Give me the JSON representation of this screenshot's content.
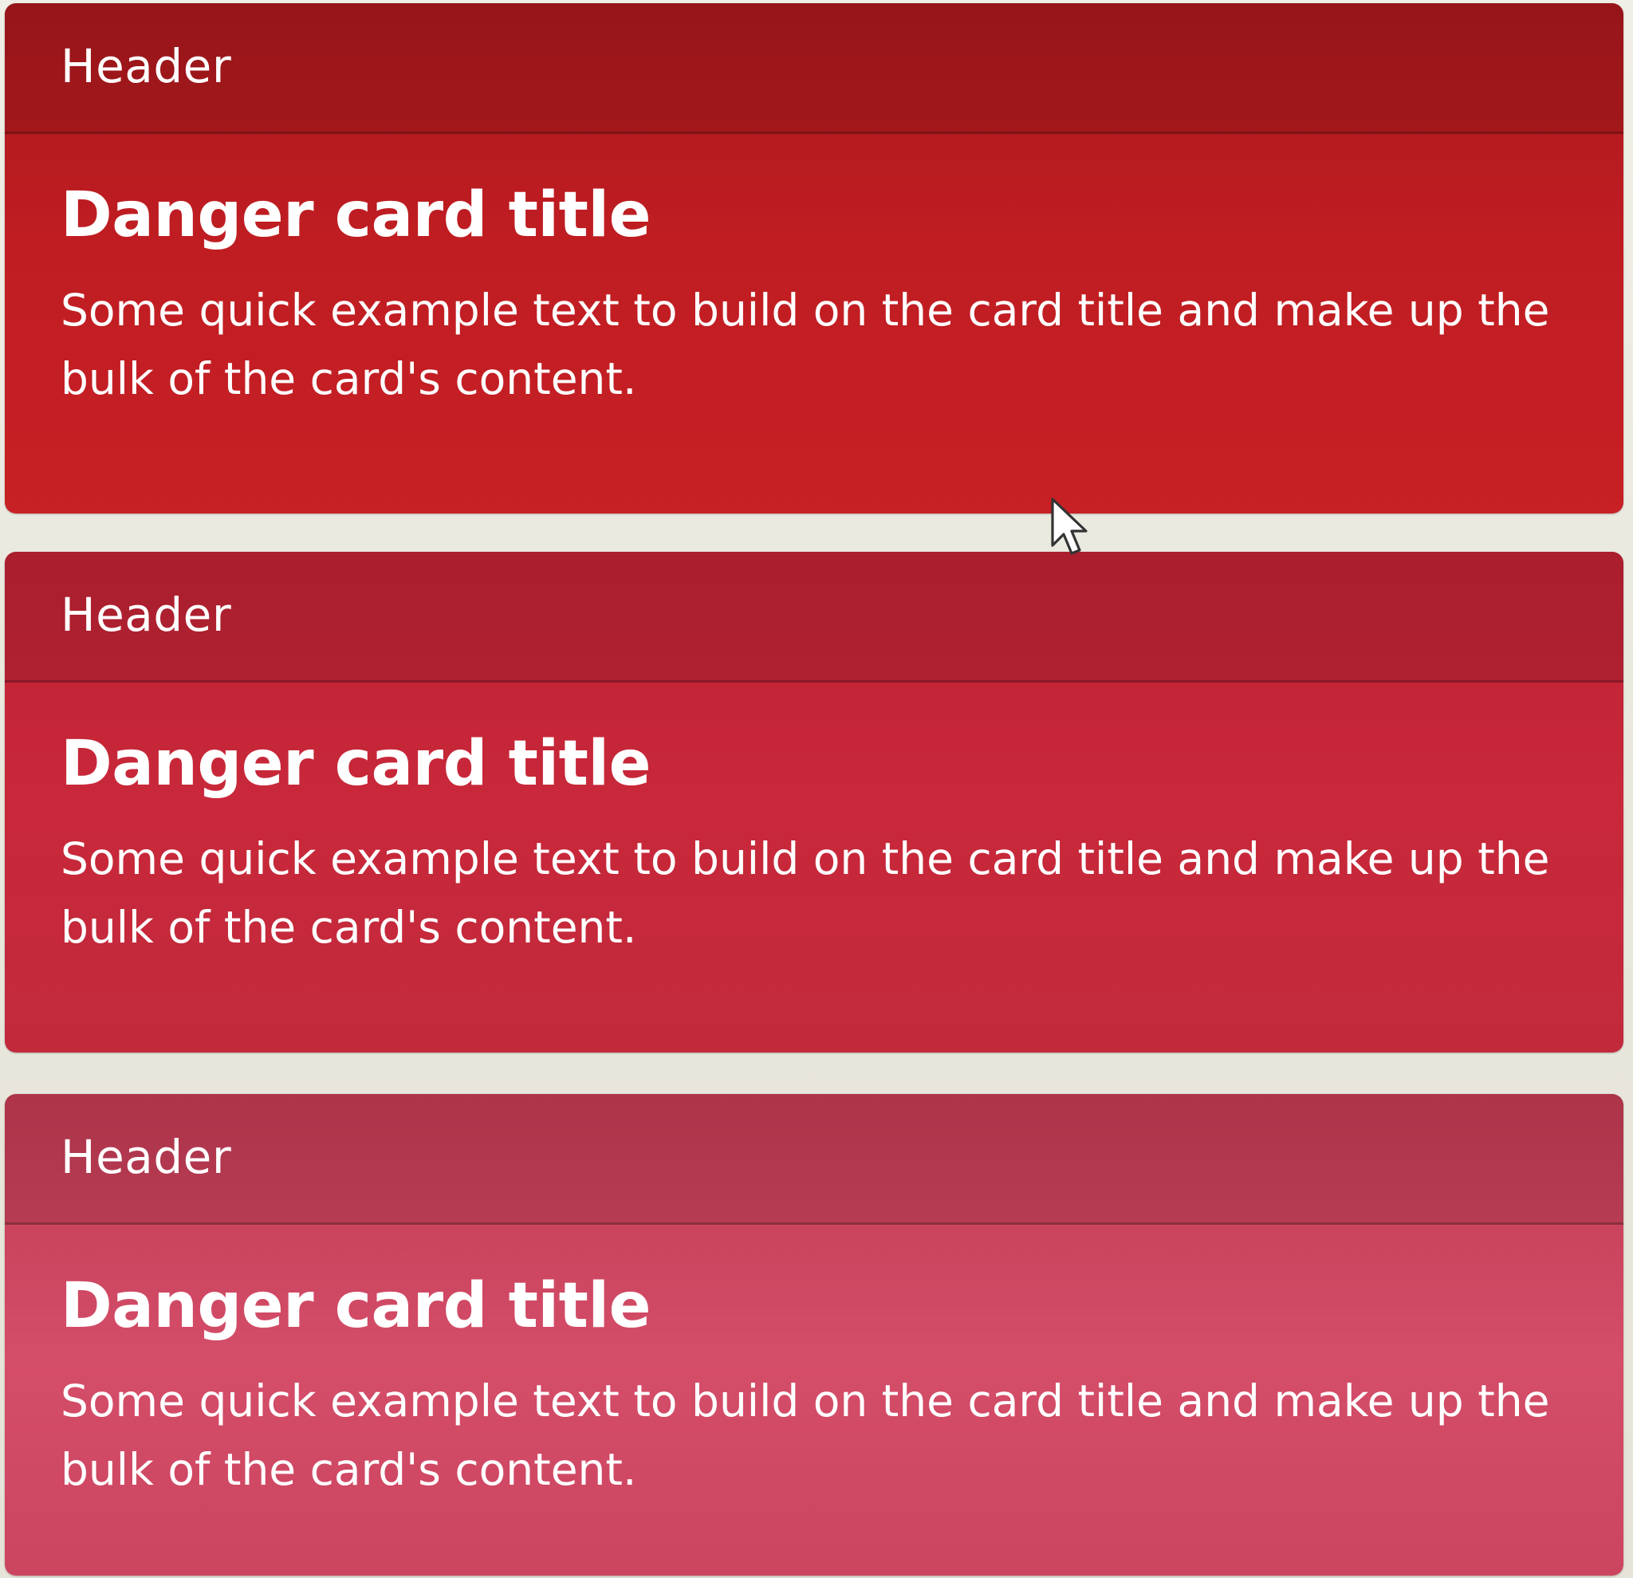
{
  "cards": [
    {
      "header": "Header",
      "title": "Danger card title",
      "text": "Some quick example text to build on the card title and make up the bulk of the card's content."
    },
    {
      "header": "Header",
      "title": "Danger card title",
      "text": "Some quick example text to build on the card title and make up the bulk of the card's content."
    },
    {
      "header": "Header",
      "title": "Danger card title",
      "text": "Some quick example text to build on the card title and make up the bulk of the card's content."
    }
  ],
  "colors": {
    "card_1": "#c01d22",
    "card_2": "#c6283a",
    "card_3": "#cf4762",
    "text": "#ffffff",
    "background": "#ecebe2"
  },
  "icons": {
    "pointer": "mouse-pointer-icon"
  }
}
